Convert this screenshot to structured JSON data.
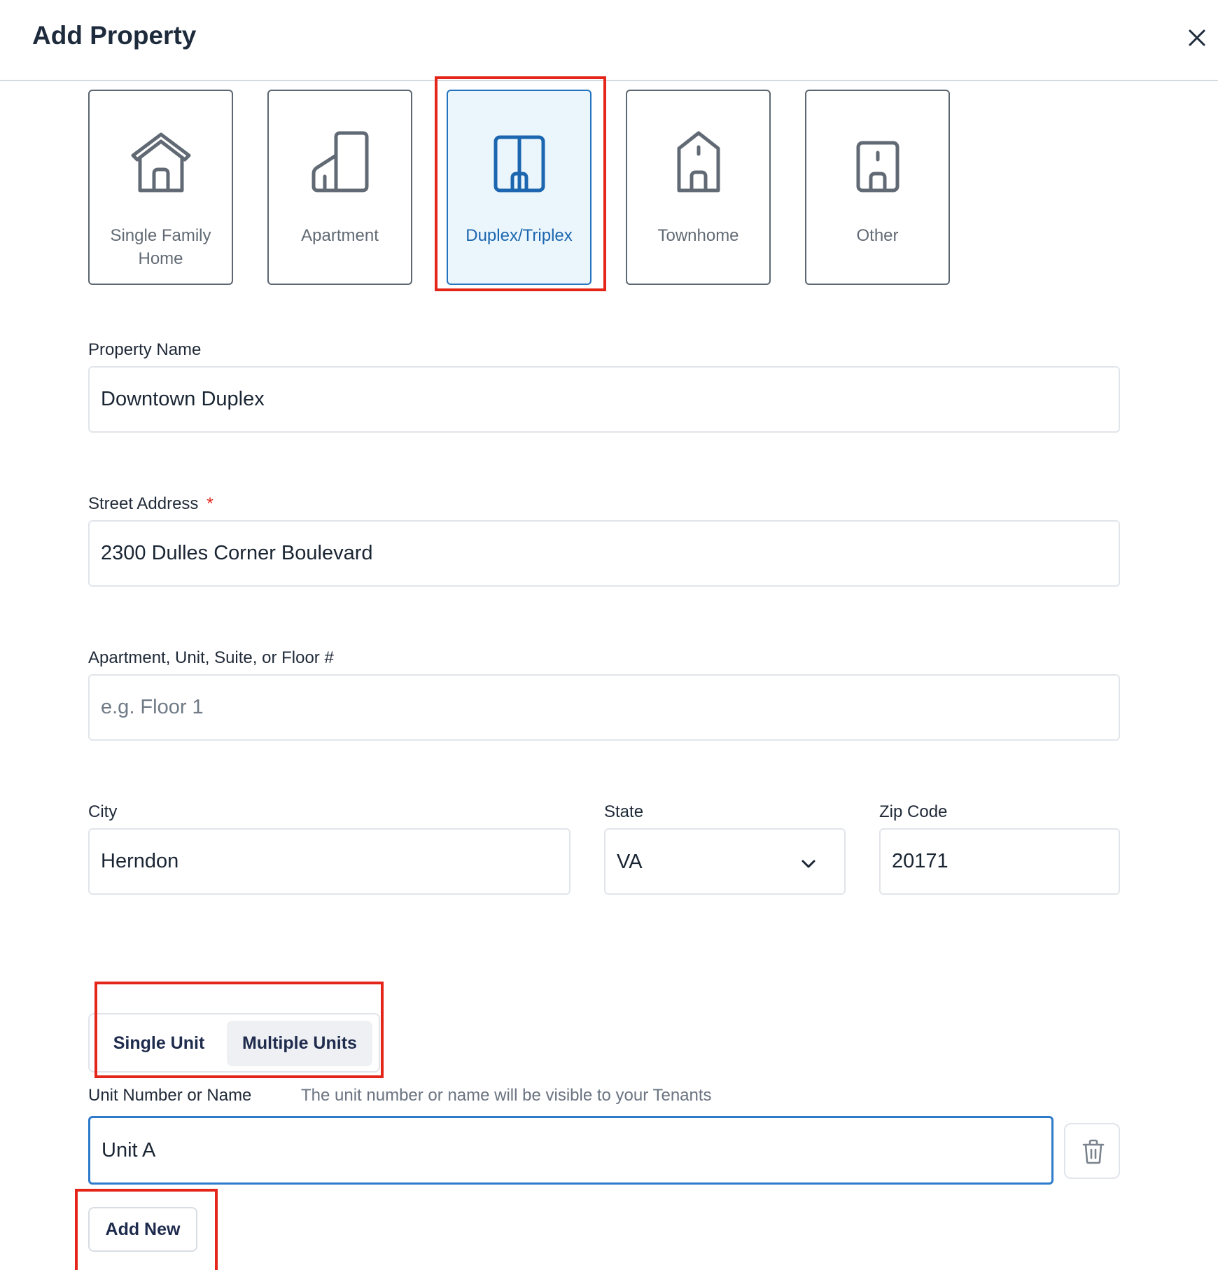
{
  "header": {
    "title": "Add Property",
    "close_icon": "close-icon"
  },
  "property_types": [
    {
      "label": "Single Family Home",
      "icon": "house-icon",
      "selected": false
    },
    {
      "label": "Apartment",
      "icon": "apartment-building-icon",
      "selected": false
    },
    {
      "label": "Duplex/Triplex",
      "icon": "duplex-icon",
      "selected": true
    },
    {
      "label": "Townhome",
      "icon": "townhome-icon",
      "selected": false
    },
    {
      "label": "Other",
      "icon": "other-building-icon",
      "selected": false
    }
  ],
  "form": {
    "property_name": {
      "label": "Property Name",
      "value": "Downtown Duplex",
      "placeholder": ""
    },
    "street_address": {
      "label": "Street Address",
      "required_mark": "*",
      "value": "2300 Dulles Corner Boulevard",
      "placeholder": ""
    },
    "unit_line": {
      "label": "Apartment, Unit, Suite, or Floor #",
      "value": "",
      "placeholder": "e.g. Floor 1"
    },
    "city": {
      "label": "City",
      "value": "Herndon"
    },
    "state": {
      "label": "State",
      "value": "VA"
    },
    "zip": {
      "label": "Zip Code",
      "value": "20171"
    }
  },
  "units": {
    "toggle": {
      "single_label": "Single Unit",
      "multiple_label": "Multiple Units",
      "active": "Multiple Units"
    },
    "unit_name": {
      "label": "Unit Number or Name",
      "hint": "The unit number or name will be visible to your Tenants",
      "value": "Unit A"
    },
    "delete_icon": "trash-icon",
    "add_new_label": "Add New"
  },
  "colors": {
    "accent": "#2473be",
    "selected_bg": "#ebf6fc",
    "highlight": "#e4251a",
    "required": "#e4251a"
  }
}
